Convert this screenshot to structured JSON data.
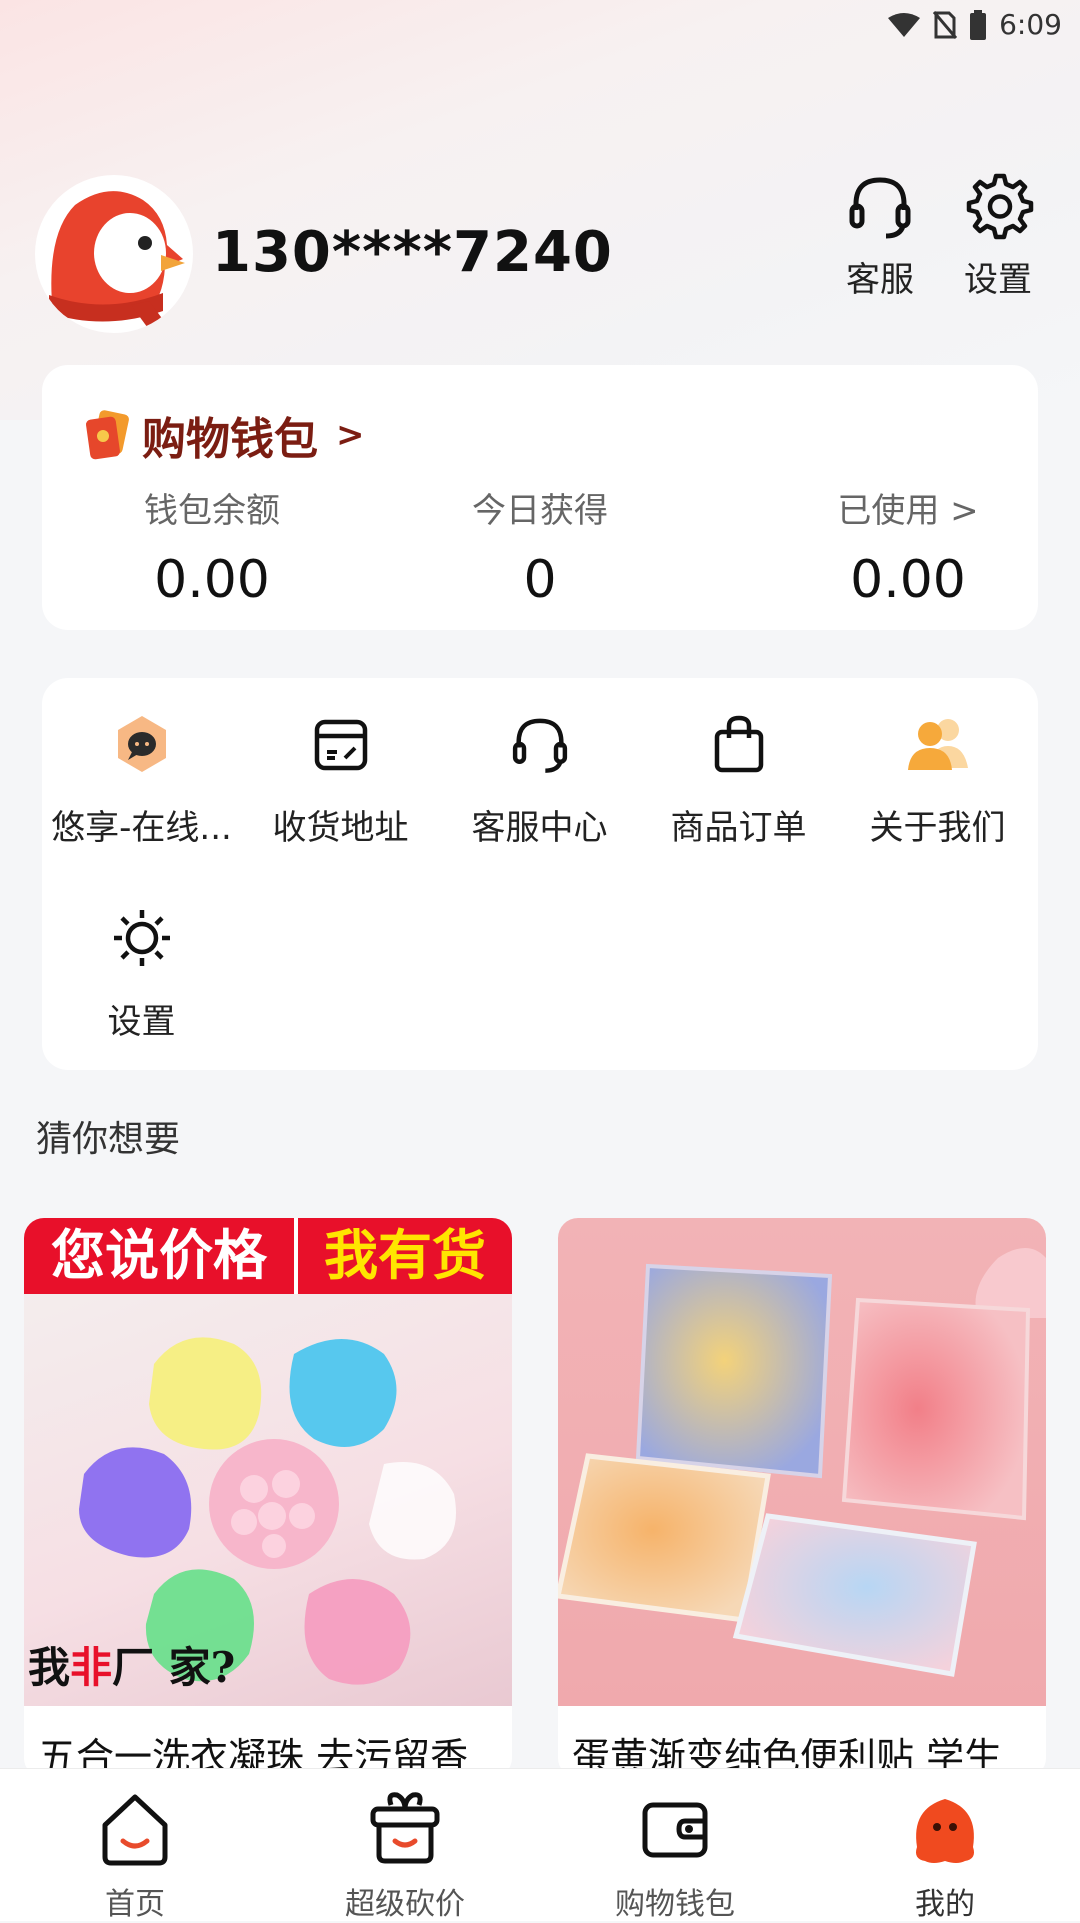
{
  "status_bar": {
    "time": "6:09"
  },
  "user": {
    "phone": "130****7240"
  },
  "header_buttons": {
    "service_label": "客服",
    "settings_label": "设置"
  },
  "wallet": {
    "title": "购物钱包",
    "title_chevron": ">",
    "balance_label": "钱包余额",
    "balance_value": "0.00",
    "today_label": "今日获得",
    "today_value": "0",
    "used_label": "已使用 >",
    "used_value": "0.00"
  },
  "menu": {
    "items": [
      {
        "label": "悠享-在线...",
        "icon": "chat-bubble-icon"
      },
      {
        "label": "收货地址",
        "icon": "address-card-icon"
      },
      {
        "label": "客服中心",
        "icon": "headset-icon"
      },
      {
        "label": "商品订单",
        "icon": "shopping-bag-icon"
      },
      {
        "label": "关于我们",
        "icon": "users-icon"
      },
      {
        "label": "设置",
        "icon": "gear-icon"
      }
    ]
  },
  "section": {
    "title": "猜你想要"
  },
  "products": [
    {
      "name": "五合一洗衣凝珠 去污留香",
      "banner_left": "您说价格",
      "banner_right": "我有货",
      "caption_1": "我",
      "caption_2": "非",
      "caption_3": "厂 家?"
    },
    {
      "name": "蛋黄渐变纯色便利贴 学生"
    }
  ],
  "bottom_nav": [
    {
      "label": "首页",
      "icon": "home-icon"
    },
    {
      "label": "超级砍价",
      "icon": "gift-basket-icon"
    },
    {
      "label": "购物钱包",
      "icon": "wallet-icon"
    },
    {
      "label": "我的",
      "icon": "profile-mascot-icon",
      "active": true
    }
  ],
  "colors": {
    "accent": "#e84b2c",
    "wallet_title": "#7b1d12",
    "nav_active": "#f04a1f"
  }
}
